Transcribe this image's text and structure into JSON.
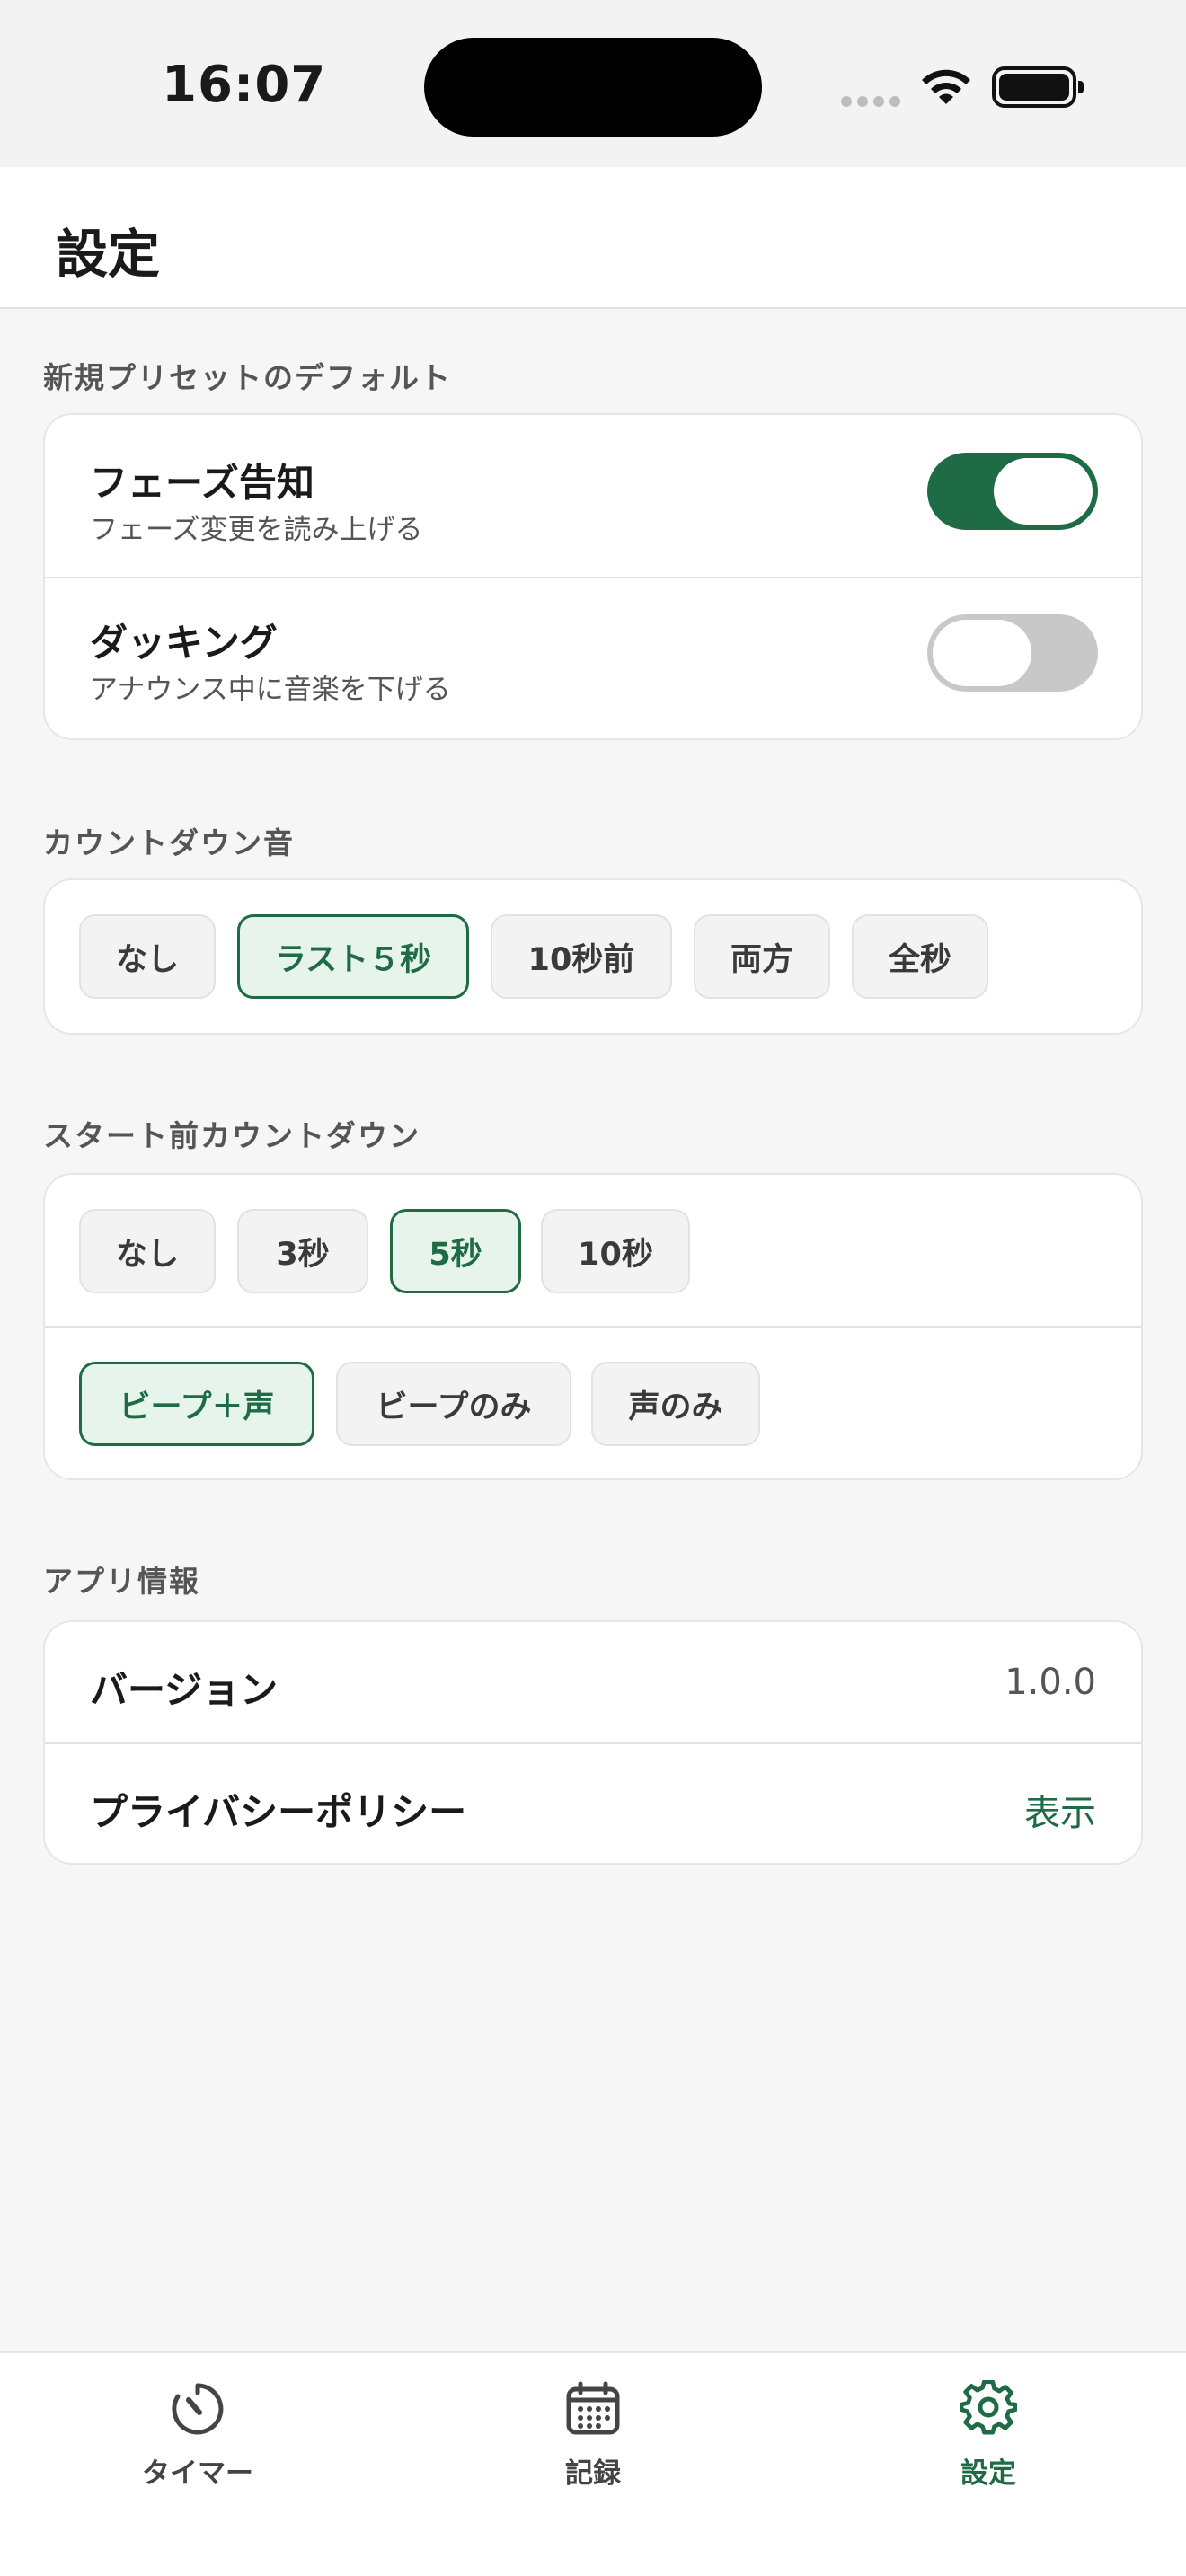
{
  "status_bar": {
    "time": "16:07"
  },
  "header": {
    "title": "設定"
  },
  "sections": {
    "preset_defaults": {
      "label": "新規プリセットのデフォルト",
      "phase_announce": {
        "title": "フェーズ告知",
        "subtitle": "フェーズ変更を読み上げる",
        "enabled": true
      },
      "ducking": {
        "title": "ダッキング",
        "subtitle": "アナウンス中に音楽を下げる",
        "enabled": false
      }
    },
    "countdown_sound": {
      "label": "カウントダウン音",
      "options": [
        "なし",
        "ラスト５秒",
        "10秒前",
        "両方",
        "全秒"
      ],
      "selected": "ラスト５秒"
    },
    "start_countdown": {
      "label": "スタート前カウントダウン",
      "duration_options": [
        "なし",
        "3秒",
        "5秒",
        "10秒"
      ],
      "duration_selected": "5秒",
      "mode_options": [
        "ビープ＋声",
        "ビープのみ",
        "声のみ"
      ],
      "mode_selected": "ビープ＋声"
    },
    "app_info": {
      "label": "アプリ情報",
      "version_label": "バージョン",
      "version_value": "1.0.0",
      "privacy_label": "プライバシーポリシー",
      "privacy_action": "表示"
    }
  },
  "tab_bar": {
    "tabs": [
      {
        "label": "タイマー",
        "icon": "timer-icon",
        "active": false
      },
      {
        "label": "記録",
        "icon": "calendar-icon",
        "active": false
      },
      {
        "label": "設定",
        "icon": "gear-icon",
        "active": true
      }
    ]
  },
  "colors": {
    "accent": "#1f6b45",
    "selected_bg": "#e7f4ec",
    "toggle_off": "#c8c8c8"
  }
}
